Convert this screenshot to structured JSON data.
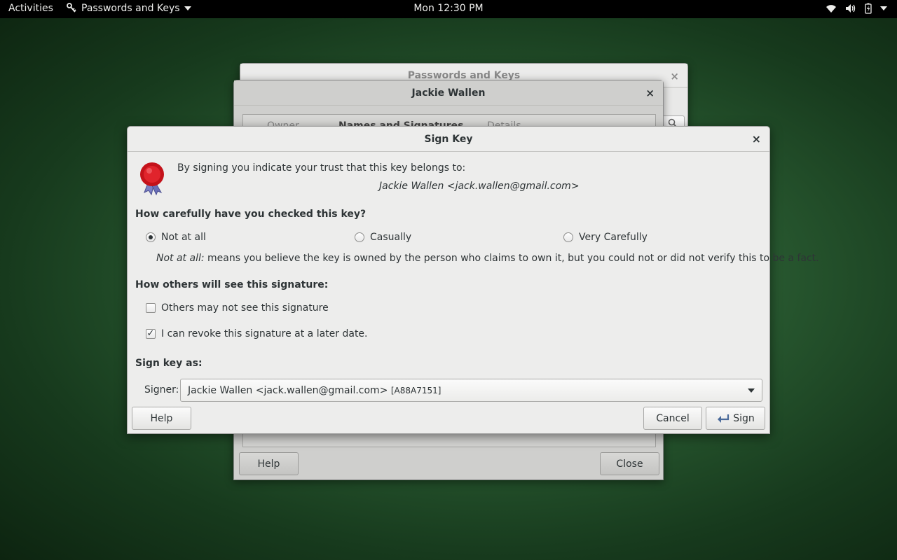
{
  "topbar": {
    "activities": "Activities",
    "app_menu": "Passwords and Keys",
    "clock": "Mon 12:30 PM"
  },
  "bg_window_1": {
    "title": "Passwords and Keys",
    "close": "×"
  },
  "bg_window_2": {
    "title": "Jackie Wallen",
    "close": "×",
    "tabs": [
      "Owner",
      "Names and Signatures",
      "Details"
    ],
    "help_label": "Help",
    "close_label": "Close"
  },
  "dialog": {
    "title": "Sign Key",
    "close": "×",
    "intro": "By signing you indicate your trust that this key belongs to:",
    "key_owner": "Jackie Wallen <jack.wallen@gmail.com>",
    "check_heading": "How carefully have you checked this key?",
    "options": [
      "Not at all",
      "Casually",
      "Very Carefully"
    ],
    "selected_option": "Not at all",
    "desc_italic": "Not at all:",
    "desc_text": " means you believe the key is owned by the person who claims to own it, but you could not or did not verify this to be a fact.",
    "visibility_heading": "How others will see this signature:",
    "checkbox_private": "Others may not see this signature",
    "checkbox_private_checked": false,
    "checkbox_revoke": "I can revoke this signature at a later date.",
    "checkbox_revoke_checked": true,
    "sign_as_heading": "Sign key as:",
    "signer_label": "Signer:",
    "signer_value": "Jackie Wallen <jack.wallen@gmail.com>",
    "signer_keyid": "[A88A7151]",
    "help_label": "Help",
    "cancel_label": "Cancel",
    "sign_label": "Sign"
  }
}
